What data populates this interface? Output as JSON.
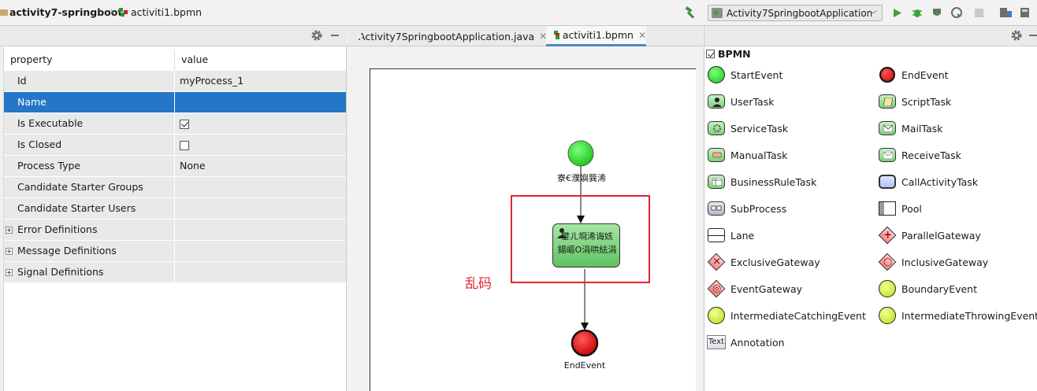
{
  "breadcrumb": {
    "project": "activity7-springboot",
    "file": "activiti1.bpmn"
  },
  "toolbar": {
    "run_config": "Activity7SpringbootApplication"
  },
  "properties": {
    "headers": {
      "property": "property",
      "value": "value"
    },
    "rows": [
      {
        "key": "Id",
        "value": "myProcess_1"
      },
      {
        "key": "Name",
        "value": ""
      },
      {
        "key": "Is Executable",
        "checked": true
      },
      {
        "key": "Is Closed",
        "checked": false
      },
      {
        "key": "Process Type",
        "value": "None"
      },
      {
        "key": "Candidate Starter Groups",
        "value": ""
      },
      {
        "key": "Candidate Starter Users",
        "value": ""
      },
      {
        "key": "Error Definitions"
      },
      {
        "key": "Message Definitions"
      },
      {
        "key": "Signal Definitions"
      }
    ]
  },
  "editor": {
    "tabs": [
      {
        "label": "Activity7SpringbootApplication.java"
      },
      {
        "label": "activiti1.bpmn"
      }
    ]
  },
  "diagram": {
    "start_label": "寮€濮嬩簨浠",
    "task_label_line1": "鐢ㄦ埛浠诲姟",
    "task_label_line2": "鍚嶇О涓哄紶涓",
    "end_label": "EndEvent",
    "annotation": "乱码",
    "colors": {
      "start": "#22dd22",
      "end": "#e80c0c",
      "highlight": "#e0262e"
    }
  },
  "palette": {
    "group": "BPMN",
    "items": [
      {
        "label": "StartEvent",
        "icon": "start-event-icon"
      },
      {
        "label": "EndEvent",
        "icon": "end-event-icon"
      },
      {
        "label": "UserTask",
        "icon": "user-task-icon"
      },
      {
        "label": "ScriptTask",
        "icon": "script-task-icon"
      },
      {
        "label": "ServiceTask",
        "icon": "service-task-icon"
      },
      {
        "label": "MailTask",
        "icon": "mail-task-icon"
      },
      {
        "label": "ManualTask",
        "icon": "manual-task-icon"
      },
      {
        "label": "ReceiveTask",
        "icon": "receive-task-icon"
      },
      {
        "label": "BusinessRuleTask",
        "icon": "business-rule-task-icon"
      },
      {
        "label": "CallActivityTask",
        "icon": "call-activity-task-icon"
      },
      {
        "label": "SubProcess",
        "icon": "sub-process-icon"
      },
      {
        "label": "Pool",
        "icon": "pool-icon"
      },
      {
        "label": "Lane",
        "icon": "lane-icon"
      },
      {
        "label": "ParallelGateway",
        "icon": "parallel-gateway-icon"
      },
      {
        "label": "ExclusiveGateway",
        "icon": "exclusive-gateway-icon"
      },
      {
        "label": "InclusiveGateway",
        "icon": "inclusive-gateway-icon"
      },
      {
        "label": "EventGateway",
        "icon": "event-gateway-icon"
      },
      {
        "label": "BoundaryEvent",
        "icon": "boundary-event-icon"
      },
      {
        "label": "IntermediateCatchingEvent",
        "icon": "intermediate-catching-event-icon"
      },
      {
        "label": "IntermediateThrowingEvent",
        "icon": "intermediate-throwing-event-icon"
      },
      {
        "label": "Annotation",
        "icon": "annotation-icon",
        "icon_text": "Text"
      }
    ]
  }
}
